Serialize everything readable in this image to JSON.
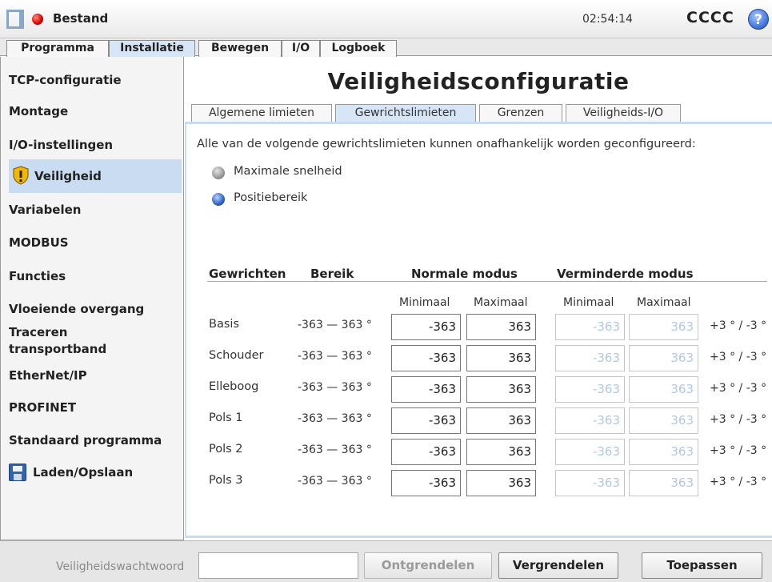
{
  "header": {
    "file_name": "Bestand",
    "clock": "02:54:14",
    "robot_name": "CCCC",
    "help_symbol": "?"
  },
  "main_tabs": [
    "Programma",
    "Installatie",
    "Bewegen",
    "I/O",
    "Logboek"
  ],
  "active_main_tab": "Installatie",
  "sidebar": {
    "items": [
      {
        "label": "TCP-configuratie"
      },
      {
        "label": "Montage"
      },
      {
        "label": "I/O-instellingen"
      },
      {
        "label": "Veiligheid",
        "icon": "warning-shield-icon",
        "active": true
      },
      {
        "label": "Variabelen"
      },
      {
        "label": "MODBUS"
      },
      {
        "label": "Functies"
      },
      {
        "label": "Vloeiende overgang"
      },
      {
        "label": "Traceren transportband"
      },
      {
        "label": "EtherNet/IP"
      },
      {
        "label": "PROFINET"
      },
      {
        "label": "Standaard programma"
      },
      {
        "label": "Laden/Opslaan",
        "icon": "floppy-disk-icon"
      }
    ]
  },
  "page_title": "Veiligheidsconfiguratie",
  "sub_tabs": [
    "Algemene limieten",
    "Gewrichtslimieten",
    "Grenzen",
    "Veiligheids-I/O"
  ],
  "active_sub_tab": "Gewrichtslimieten",
  "intro_text": "Alle van de volgende gewrichtslimieten kunnen onafhankelijk worden geconfigureerd:",
  "options": [
    {
      "label": "Maximale snelheid",
      "selected": false
    },
    {
      "label": "Positiebereik",
      "selected": true
    }
  ],
  "table": {
    "headers": {
      "joints": "Gewrichten",
      "range": "Bereik",
      "normal": "Normale modus",
      "reduced": "Verminderde modus"
    },
    "subheaders": {
      "normal_min": "Minimaal",
      "normal_max": "Maximaal",
      "reduced_min": "Minimaal",
      "reduced_max": "Maximaal"
    },
    "rows": [
      {
        "joint": "Basis",
        "range": "-363 — 363 °",
        "normal_min": "-363",
        "normal_max": "363",
        "reduced_min": "-363",
        "reduced_max": "363",
        "tolerance": "+3 ° / -3 °"
      },
      {
        "joint": "Schouder",
        "range": "-363 — 363 °",
        "normal_min": "-363",
        "normal_max": "363",
        "reduced_min": "-363",
        "reduced_max": "363",
        "tolerance": "+3 ° / -3 °"
      },
      {
        "joint": "Elleboog",
        "range": "-363 — 363 °",
        "normal_min": "-363",
        "normal_max": "363",
        "reduced_min": "-363",
        "reduced_max": "363",
        "tolerance": "+3 ° / -3 °"
      },
      {
        "joint": "Pols 1",
        "range": "-363 — 363 °",
        "normal_min": "-363",
        "normal_max": "363",
        "reduced_min": "-363",
        "reduced_max": "363",
        "tolerance": "+3 ° / -3 °"
      },
      {
        "joint": "Pols 2",
        "range": "-363 — 363 °",
        "normal_min": "-363",
        "normal_max": "363",
        "reduced_min": "-363",
        "reduced_max": "363",
        "tolerance": "+3 ° / -3 °"
      },
      {
        "joint": "Pols 3",
        "range": "-363 — 363 °",
        "normal_min": "-363",
        "normal_max": "363",
        "reduced_min": "-363",
        "reduced_max": "363",
        "tolerance": "+3 ° / -3 °"
      }
    ]
  },
  "footer": {
    "password_label": "Veiligheidswachtwoord",
    "password_value": "",
    "unlock_label": "Ontgrendelen",
    "lock_label": "Vergrendelen",
    "apply_label": "Toepassen"
  },
  "colors": {
    "active_tab": "#d7e6f7",
    "active_sidebar": "#c9dcf2",
    "record_dot": "#d50000",
    "help_button": "#3c6fd8",
    "disabled_value": "#b0c8e8"
  }
}
